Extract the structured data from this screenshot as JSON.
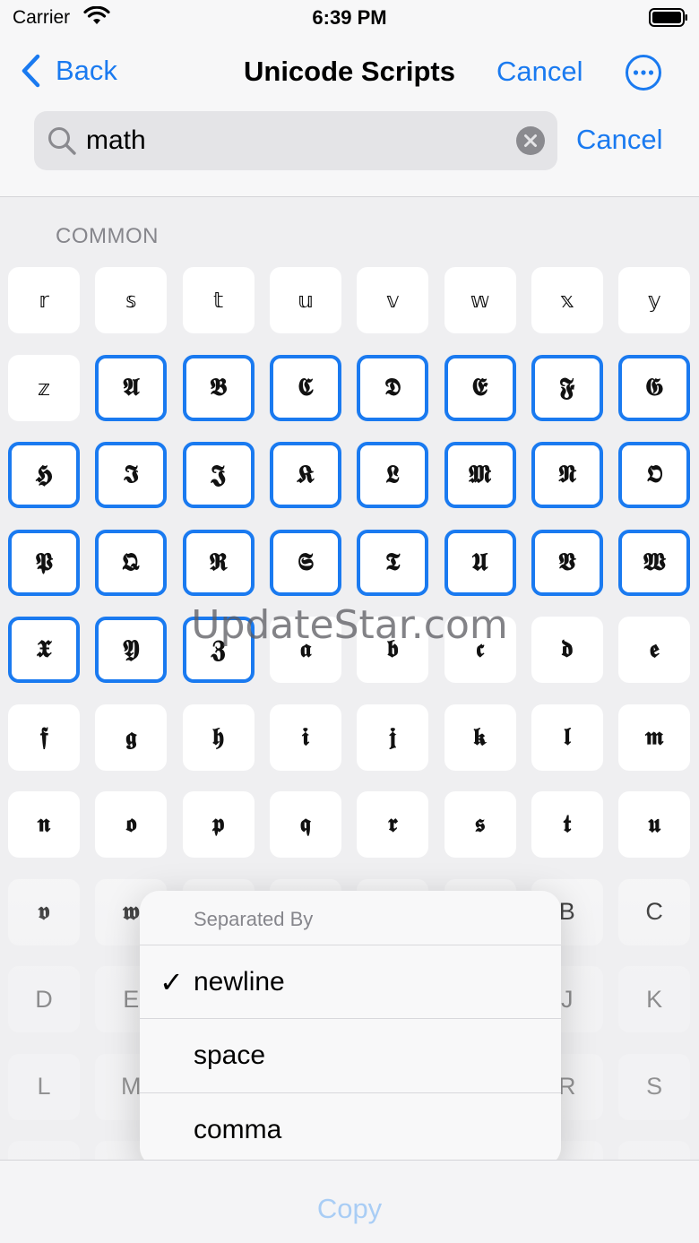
{
  "status_bar": {
    "carrier": "Carrier",
    "time": "6:39 PM"
  },
  "nav": {
    "back_label": "Back",
    "title": "Unicode Scripts",
    "cancel_label": "Cancel"
  },
  "search": {
    "value": "math",
    "cancel_label": "Cancel"
  },
  "section": {
    "title": "COMMON"
  },
  "grid": [
    {
      "char": "𝕣",
      "state": "normal",
      "style": "dstruck"
    },
    {
      "char": "𝕤",
      "state": "normal",
      "style": "dstruck"
    },
    {
      "char": "𝕥",
      "state": "normal",
      "style": "dstruck"
    },
    {
      "char": "𝕦",
      "state": "normal",
      "style": "dstruck"
    },
    {
      "char": "𝕧",
      "state": "normal",
      "style": "dstruck"
    },
    {
      "char": "𝕨",
      "state": "normal",
      "style": "dstruck"
    },
    {
      "char": "𝕩",
      "state": "normal",
      "style": "dstruck"
    },
    {
      "char": "𝕪",
      "state": "normal",
      "style": "dstruck"
    },
    {
      "char": "𝕫",
      "state": "normal",
      "style": "dstruck"
    },
    {
      "char": "𝕬",
      "state": "selected",
      "style": "frak"
    },
    {
      "char": "𝕭",
      "state": "selected",
      "style": "frak"
    },
    {
      "char": "𝕮",
      "state": "selected",
      "style": "frak"
    },
    {
      "char": "𝕯",
      "state": "selected",
      "style": "frak"
    },
    {
      "char": "𝕰",
      "state": "selected",
      "style": "frak"
    },
    {
      "char": "𝕱",
      "state": "selected",
      "style": "frak"
    },
    {
      "char": "𝕲",
      "state": "selected",
      "style": "frak"
    },
    {
      "char": "𝕳",
      "state": "selected",
      "style": "frak"
    },
    {
      "char": "𝕴",
      "state": "selected",
      "style": "frak"
    },
    {
      "char": "𝕵",
      "state": "selected",
      "style": "frak"
    },
    {
      "char": "𝕶",
      "state": "selected",
      "style": "frak"
    },
    {
      "char": "𝕷",
      "state": "selected",
      "style": "frak"
    },
    {
      "char": "𝕸",
      "state": "selected",
      "style": "frak"
    },
    {
      "char": "𝕹",
      "state": "selected",
      "style": "frak"
    },
    {
      "char": "𝕺",
      "state": "selected",
      "style": "frak"
    },
    {
      "char": "𝕻",
      "state": "selected",
      "style": "frak"
    },
    {
      "char": "𝕼",
      "state": "selected",
      "style": "frak"
    },
    {
      "char": "𝕽",
      "state": "selected",
      "style": "frak"
    },
    {
      "char": "𝕾",
      "state": "selected",
      "style": "frak"
    },
    {
      "char": "𝕿",
      "state": "selected",
      "style": "frak"
    },
    {
      "char": "𝖀",
      "state": "selected",
      "style": "frak"
    },
    {
      "char": "𝖁",
      "state": "selected",
      "style": "frak"
    },
    {
      "char": "𝖂",
      "state": "selected",
      "style": "frak"
    },
    {
      "char": "𝖃",
      "state": "selected",
      "style": "frak"
    },
    {
      "char": "𝖄",
      "state": "selected",
      "style": "frak"
    },
    {
      "char": "𝖅",
      "state": "selected",
      "style": "frak"
    },
    {
      "char": "𝖆",
      "state": "normal",
      "style": "frak"
    },
    {
      "char": "𝖇",
      "state": "normal",
      "style": "frak"
    },
    {
      "char": "𝖈",
      "state": "normal",
      "style": "frak"
    },
    {
      "char": "𝖉",
      "state": "normal",
      "style": "frak"
    },
    {
      "char": "𝖊",
      "state": "normal",
      "style": "frak"
    },
    {
      "char": "𝖋",
      "state": "normal",
      "style": "frak"
    },
    {
      "char": "𝖌",
      "state": "normal",
      "style": "frak"
    },
    {
      "char": "𝖍",
      "state": "normal",
      "style": "frak"
    },
    {
      "char": "𝖎",
      "state": "normal",
      "style": "frak"
    },
    {
      "char": "𝖏",
      "state": "normal",
      "style": "frak"
    },
    {
      "char": "𝖐",
      "state": "normal",
      "style": "frak"
    },
    {
      "char": "𝖑",
      "state": "normal",
      "style": "frak"
    },
    {
      "char": "𝖒",
      "state": "normal",
      "style": "frak"
    },
    {
      "char": "𝖓",
      "state": "normal",
      "style": "frak"
    },
    {
      "char": "𝖔",
      "state": "normal",
      "style": "frak"
    },
    {
      "char": "𝖕",
      "state": "normal",
      "style": "frak"
    },
    {
      "char": "𝖖",
      "state": "normal",
      "style": "frak"
    },
    {
      "char": "𝖗",
      "state": "normal",
      "style": "frak"
    },
    {
      "char": "𝖘",
      "state": "normal",
      "style": "frak"
    },
    {
      "char": "𝖙",
      "state": "normal",
      "style": "frak"
    },
    {
      "char": "𝖚",
      "state": "normal",
      "style": "frak"
    },
    {
      "char": "𝖛",
      "state": "dim",
      "style": "frak"
    },
    {
      "char": "𝖜",
      "state": "dim",
      "style": "frak"
    },
    {
      "char": "",
      "state": "dim",
      "style": "plain"
    },
    {
      "char": "",
      "state": "dim",
      "style": "plain"
    },
    {
      "char": "",
      "state": "dim",
      "style": "plain"
    },
    {
      "char": "",
      "state": "dim",
      "style": "plain"
    },
    {
      "char": "B",
      "state": "dim",
      "style": "plain"
    },
    {
      "char": "C",
      "state": "dim",
      "style": "plain"
    },
    {
      "char": "D",
      "state": "dim",
      "style": "plain"
    },
    {
      "char": "E",
      "state": "dim",
      "style": "plain"
    },
    {
      "char": "",
      "state": "dim",
      "style": "plain"
    },
    {
      "char": "",
      "state": "dim",
      "style": "plain"
    },
    {
      "char": "",
      "state": "dim",
      "style": "plain"
    },
    {
      "char": "",
      "state": "dim",
      "style": "plain"
    },
    {
      "char": "J",
      "state": "dim",
      "style": "plain"
    },
    {
      "char": "K",
      "state": "dim",
      "style": "plain"
    },
    {
      "char": "L",
      "state": "dim",
      "style": "plain"
    },
    {
      "char": "M",
      "state": "dim",
      "style": "plain"
    },
    {
      "char": "",
      "state": "dim",
      "style": "plain"
    },
    {
      "char": "",
      "state": "dim",
      "style": "plain"
    },
    {
      "char": "",
      "state": "dim",
      "style": "plain"
    },
    {
      "char": "",
      "state": "dim",
      "style": "plain"
    },
    {
      "char": "R",
      "state": "dim",
      "style": "plain"
    },
    {
      "char": "S",
      "state": "dim",
      "style": "plain"
    },
    {
      "char": "",
      "state": "dim",
      "style": "plain"
    },
    {
      "char": "",
      "state": "dim",
      "style": "plain"
    },
    {
      "char": "",
      "state": "dim",
      "style": "plain"
    },
    {
      "char": "",
      "state": "dim",
      "style": "plain"
    },
    {
      "char": "",
      "state": "dim",
      "style": "plain"
    },
    {
      "char": "",
      "state": "dim",
      "style": "plain"
    },
    {
      "char": "",
      "state": "dim",
      "style": "plain"
    },
    {
      "char": "",
      "state": "dim",
      "style": "plain"
    }
  ],
  "watermark": "UpdateStar.com",
  "menu": {
    "title": "Separated By",
    "items": [
      {
        "label": "newline",
        "check": "✓"
      },
      {
        "label": "space",
        "check": ""
      },
      {
        "label": "comma",
        "check": ""
      }
    ]
  },
  "toolbar": {
    "copy_label": "Copy"
  },
  "colors": {
    "accent": "#1a7af0",
    "disabled": "#a9cdf5",
    "section": "#86868c"
  }
}
